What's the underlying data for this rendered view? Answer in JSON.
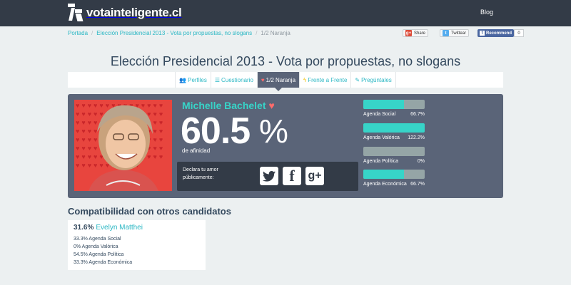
{
  "navbar": {
    "logo_text": "votainteligente.cl",
    "blog_label": "Blog"
  },
  "breadcrumb": {
    "items": [
      "Portada",
      "Elección Presidencial 2013 - Vota por propuestas, no slogans"
    ],
    "current": "1/2 Naranja"
  },
  "social": {
    "gplus_label": "Share",
    "twitter_label": "Twittear",
    "facebook_label": "Recommend",
    "facebook_count": "0"
  },
  "page_title": "Elección Presidencial 2013 - Vota por propuestas, no slogans",
  "tabs": [
    {
      "icon": "users-icon",
      "label": "Perfiles"
    },
    {
      "icon": "list-icon",
      "label": "Cuestionario"
    },
    {
      "icon": "heart-icon",
      "label": "1/2 Naranja"
    },
    {
      "icon": "bolt-icon",
      "label": "Frente a Frente"
    },
    {
      "icon": "edit-icon",
      "label": "Pregúntales"
    }
  ],
  "active_tab": "1/2 Naranja",
  "candidate": {
    "name": "Michelle Bachelet",
    "percentage": "60.5",
    "percent_sign": "%",
    "affinity_label": "de afinidad",
    "share_label": "Declara tu amor públicamente:",
    "share_icons": [
      "twitter-icon",
      "facebook-icon",
      "google-plus-icon"
    ]
  },
  "agendas": [
    {
      "label": "Agenda Social",
      "value": "66.7%",
      "fill": 0.667
    },
    {
      "label": "Agenda Valórica",
      "value": "122.2%",
      "fill": 1.0
    },
    {
      "label": "Agenda Política",
      "value": "0%",
      "fill": 0.0
    },
    {
      "label": "Agenda Económica",
      "value": "66.7%",
      "fill": 0.667
    }
  ],
  "compat": {
    "title": "Compatibilidad con otros candidatos",
    "percentage": "31.6%",
    "candidate": "Evelyn Matthei",
    "lines": [
      "33.3% Agenda Social",
      "0% Agenda Valórica",
      "54.5% Agenda Política",
      "33.3% Agenda Económica"
    ]
  },
  "colors": {
    "navbar": "#333b47",
    "accent": "#37d4c8",
    "link": "#2ab7c4",
    "panel": "#5a6478",
    "photo_bg": "#e8453e"
  }
}
